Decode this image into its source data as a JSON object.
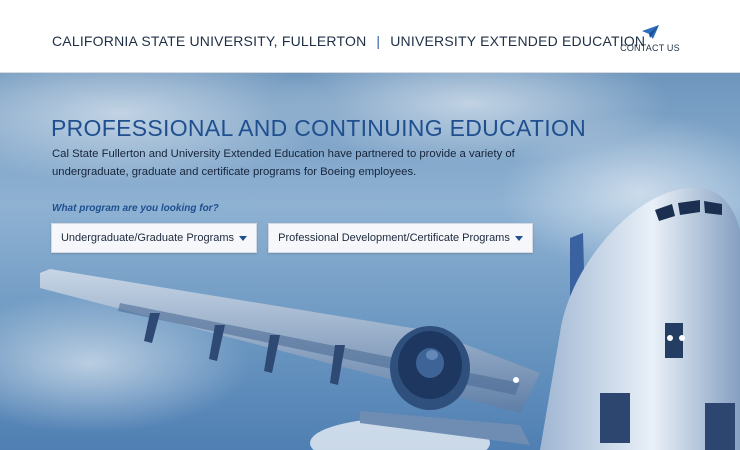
{
  "header": {
    "university": "CALIFORNIA STATE UNIVERSITY, FULLERTON",
    "separator": "|",
    "division": "UNIVERSITY EXTENDED EDUCATION",
    "contact_label": "CONTACT US",
    "contact_icon": "paper-plane-icon"
  },
  "hero": {
    "title": "PROFESSIONAL AND CONTINUING EDUCATION",
    "description": "Cal State Fullerton and University Extended Education have partnered to provide a variety of undergraduate, graduate and certificate programs for Boeing employees.",
    "question": "What program are you looking for?",
    "buttons": [
      {
        "label": "Undergraduate/Graduate Programs",
        "icon": "caret-down-icon"
      },
      {
        "label": "Professional Development/Certificate Programs",
        "icon": "caret-down-icon"
      }
    ]
  },
  "colors": {
    "title_blue": "#1f4f8f",
    "accent_blue": "#2d5fa8"
  }
}
